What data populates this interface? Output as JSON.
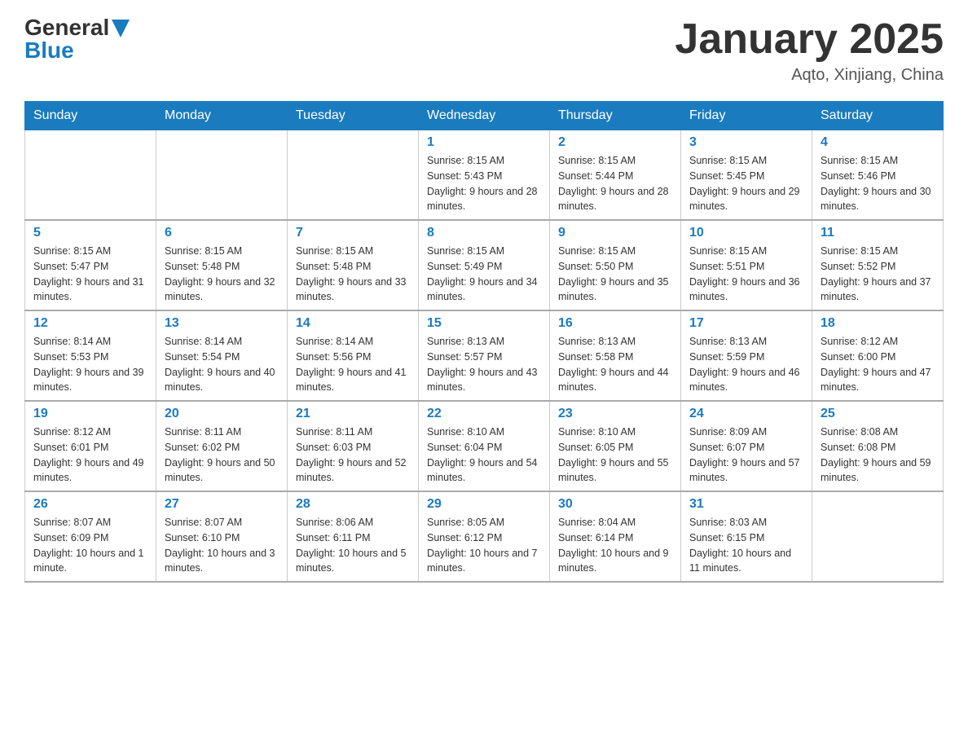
{
  "header": {
    "logo_general": "General",
    "logo_blue": "Blue",
    "month": "January 2025",
    "location": "Aqto, Xinjiang, China"
  },
  "days_of_week": [
    "Sunday",
    "Monday",
    "Tuesday",
    "Wednesday",
    "Thursday",
    "Friday",
    "Saturday"
  ],
  "weeks": [
    [
      {
        "day": "",
        "info": ""
      },
      {
        "day": "",
        "info": ""
      },
      {
        "day": "",
        "info": ""
      },
      {
        "day": "1",
        "info": "Sunrise: 8:15 AM\nSunset: 5:43 PM\nDaylight: 9 hours and 28 minutes."
      },
      {
        "day": "2",
        "info": "Sunrise: 8:15 AM\nSunset: 5:44 PM\nDaylight: 9 hours and 28 minutes."
      },
      {
        "day": "3",
        "info": "Sunrise: 8:15 AM\nSunset: 5:45 PM\nDaylight: 9 hours and 29 minutes."
      },
      {
        "day": "4",
        "info": "Sunrise: 8:15 AM\nSunset: 5:46 PM\nDaylight: 9 hours and 30 minutes."
      }
    ],
    [
      {
        "day": "5",
        "info": "Sunrise: 8:15 AM\nSunset: 5:47 PM\nDaylight: 9 hours and 31 minutes."
      },
      {
        "day": "6",
        "info": "Sunrise: 8:15 AM\nSunset: 5:48 PM\nDaylight: 9 hours and 32 minutes."
      },
      {
        "day": "7",
        "info": "Sunrise: 8:15 AM\nSunset: 5:48 PM\nDaylight: 9 hours and 33 minutes."
      },
      {
        "day": "8",
        "info": "Sunrise: 8:15 AM\nSunset: 5:49 PM\nDaylight: 9 hours and 34 minutes."
      },
      {
        "day": "9",
        "info": "Sunrise: 8:15 AM\nSunset: 5:50 PM\nDaylight: 9 hours and 35 minutes."
      },
      {
        "day": "10",
        "info": "Sunrise: 8:15 AM\nSunset: 5:51 PM\nDaylight: 9 hours and 36 minutes."
      },
      {
        "day": "11",
        "info": "Sunrise: 8:15 AM\nSunset: 5:52 PM\nDaylight: 9 hours and 37 minutes."
      }
    ],
    [
      {
        "day": "12",
        "info": "Sunrise: 8:14 AM\nSunset: 5:53 PM\nDaylight: 9 hours and 39 minutes."
      },
      {
        "day": "13",
        "info": "Sunrise: 8:14 AM\nSunset: 5:54 PM\nDaylight: 9 hours and 40 minutes."
      },
      {
        "day": "14",
        "info": "Sunrise: 8:14 AM\nSunset: 5:56 PM\nDaylight: 9 hours and 41 minutes."
      },
      {
        "day": "15",
        "info": "Sunrise: 8:13 AM\nSunset: 5:57 PM\nDaylight: 9 hours and 43 minutes."
      },
      {
        "day": "16",
        "info": "Sunrise: 8:13 AM\nSunset: 5:58 PM\nDaylight: 9 hours and 44 minutes."
      },
      {
        "day": "17",
        "info": "Sunrise: 8:13 AM\nSunset: 5:59 PM\nDaylight: 9 hours and 46 minutes."
      },
      {
        "day": "18",
        "info": "Sunrise: 8:12 AM\nSunset: 6:00 PM\nDaylight: 9 hours and 47 minutes."
      }
    ],
    [
      {
        "day": "19",
        "info": "Sunrise: 8:12 AM\nSunset: 6:01 PM\nDaylight: 9 hours and 49 minutes."
      },
      {
        "day": "20",
        "info": "Sunrise: 8:11 AM\nSunset: 6:02 PM\nDaylight: 9 hours and 50 minutes."
      },
      {
        "day": "21",
        "info": "Sunrise: 8:11 AM\nSunset: 6:03 PM\nDaylight: 9 hours and 52 minutes."
      },
      {
        "day": "22",
        "info": "Sunrise: 8:10 AM\nSunset: 6:04 PM\nDaylight: 9 hours and 54 minutes."
      },
      {
        "day": "23",
        "info": "Sunrise: 8:10 AM\nSunset: 6:05 PM\nDaylight: 9 hours and 55 minutes."
      },
      {
        "day": "24",
        "info": "Sunrise: 8:09 AM\nSunset: 6:07 PM\nDaylight: 9 hours and 57 minutes."
      },
      {
        "day": "25",
        "info": "Sunrise: 8:08 AM\nSunset: 6:08 PM\nDaylight: 9 hours and 59 minutes."
      }
    ],
    [
      {
        "day": "26",
        "info": "Sunrise: 8:07 AM\nSunset: 6:09 PM\nDaylight: 10 hours and 1 minute."
      },
      {
        "day": "27",
        "info": "Sunrise: 8:07 AM\nSunset: 6:10 PM\nDaylight: 10 hours and 3 minutes."
      },
      {
        "day": "28",
        "info": "Sunrise: 8:06 AM\nSunset: 6:11 PM\nDaylight: 10 hours and 5 minutes."
      },
      {
        "day": "29",
        "info": "Sunrise: 8:05 AM\nSunset: 6:12 PM\nDaylight: 10 hours and 7 minutes."
      },
      {
        "day": "30",
        "info": "Sunrise: 8:04 AM\nSunset: 6:14 PM\nDaylight: 10 hours and 9 minutes."
      },
      {
        "day": "31",
        "info": "Sunrise: 8:03 AM\nSunset: 6:15 PM\nDaylight: 10 hours and 11 minutes."
      },
      {
        "day": "",
        "info": ""
      }
    ]
  ]
}
